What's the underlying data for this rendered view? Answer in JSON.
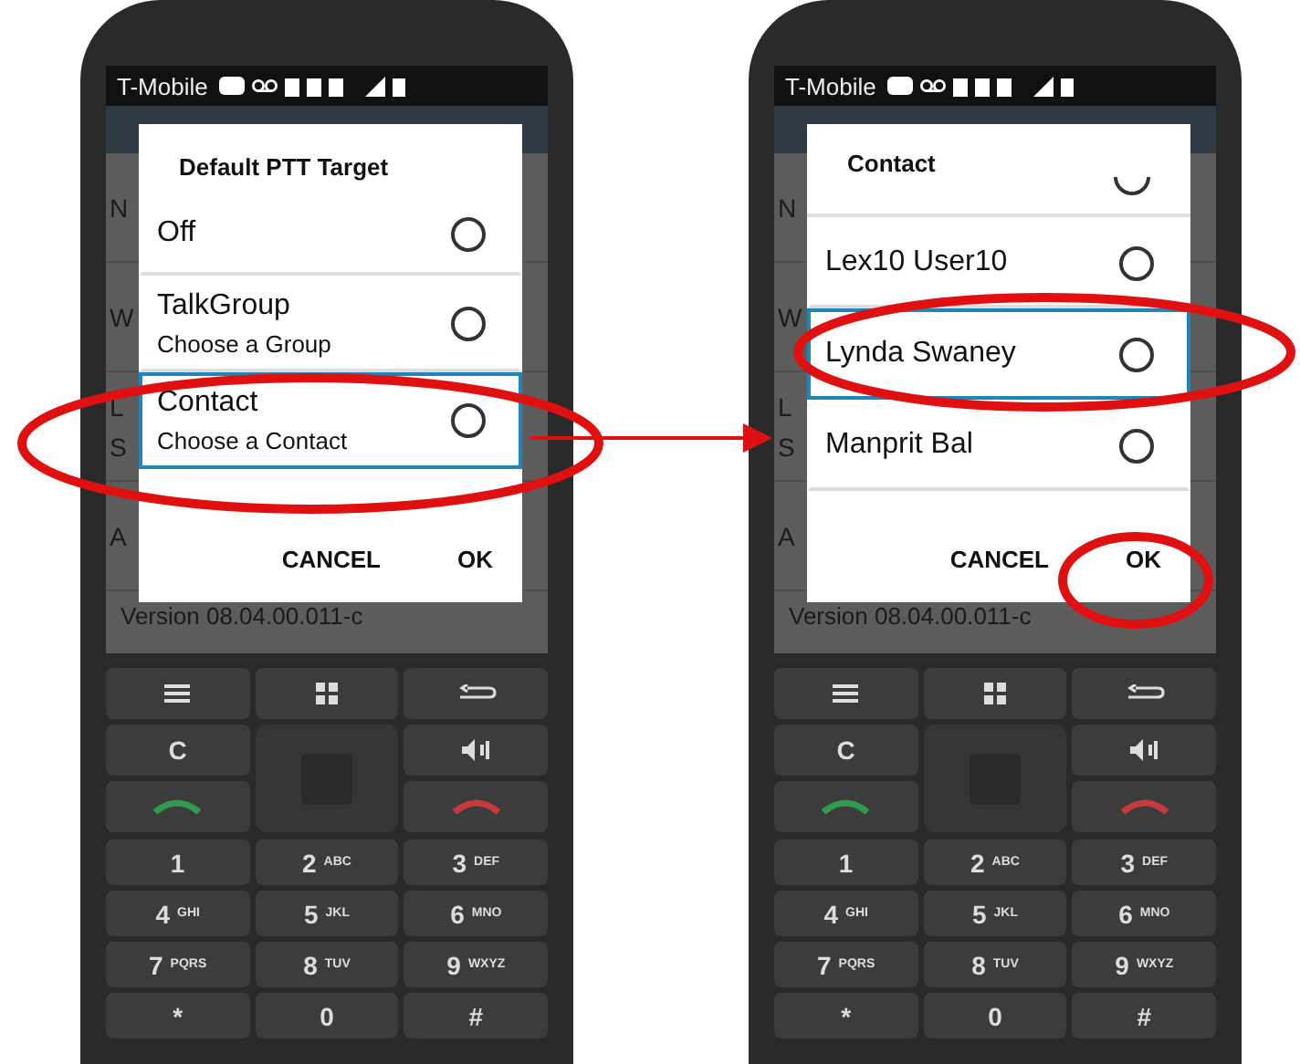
{
  "phones": [
    {
      "status_bar": {
        "carrier": "T-Mobile"
      },
      "background_rows": [
        {
          "texts": [
            "N"
          ]
        },
        {
          "texts": [
            "W"
          ]
        },
        {
          "texts": [
            "L",
            "S"
          ]
        },
        {
          "texts": [
            "A"
          ]
        }
      ],
      "version": "Version 08.04.00.011-c",
      "dialog": {
        "title": "Default PTT Target",
        "options": [
          {
            "label": "Off",
            "selected": false,
            "highlighted": false
          },
          {
            "label": "TalkGroup",
            "sublabel": "Choose a Group",
            "selected": false,
            "highlighted": false
          },
          {
            "label": "Contact",
            "sublabel": "Choose a Contact",
            "selected": false,
            "highlighted": true
          }
        ],
        "buttons": [
          "CANCEL",
          "OK"
        ]
      },
      "function_keys": [
        {
          "kind": "menu"
        },
        {
          "kind": "home"
        },
        {
          "kind": "back"
        },
        {
          "kind": "clear",
          "label": "C"
        },
        {
          "kind": "volume"
        },
        {
          "kind": "call"
        },
        {
          "kind": "end"
        }
      ],
      "digit_keys": [
        {
          "digit": "1"
        },
        {
          "digit": "2",
          "letters": "ABC"
        },
        {
          "digit": "3",
          "letters": "DEF"
        },
        {
          "digit": "4",
          "letters": "GHI"
        },
        {
          "digit": "5",
          "letters": "JKL"
        },
        {
          "digit": "6",
          "letters": "MNO"
        },
        {
          "digit": "7",
          "letters": "PQRS"
        },
        {
          "digit": "8",
          "letters": "TUV"
        },
        {
          "digit": "9",
          "letters": "WXYZ"
        },
        {
          "digit": "*"
        },
        {
          "digit": "0"
        },
        {
          "digit": "#"
        }
      ]
    },
    {
      "status_bar": {
        "carrier": "T-Mobile"
      },
      "background_rows": [
        {
          "texts": [
            "N"
          ]
        },
        {
          "texts": [
            "W"
          ]
        },
        {
          "texts": [
            "L",
            "S"
          ]
        },
        {
          "texts": [
            "A"
          ]
        }
      ],
      "version": "Version 08.04.00.011-c",
      "dialog": {
        "title": "Contact",
        "partial_option": {
          "selected": false
        },
        "options": [
          {
            "label": "Lex10 User10",
            "selected": false,
            "highlighted": false
          },
          {
            "label": "Lynda  Swaney",
            "selected": false,
            "highlighted": true
          },
          {
            "label": "Manprit Bal",
            "selected": false,
            "highlighted": false
          }
        ],
        "buttons": [
          "CANCEL",
          "OK"
        ]
      },
      "function_keys": [
        {
          "kind": "menu"
        },
        {
          "kind": "home"
        },
        {
          "kind": "back"
        },
        {
          "kind": "clear",
          "label": "C"
        },
        {
          "kind": "volume"
        },
        {
          "kind": "call"
        },
        {
          "kind": "end"
        }
      ],
      "digit_keys": [
        {
          "digit": "1"
        },
        {
          "digit": "2",
          "letters": "ABC"
        },
        {
          "digit": "3",
          "letters": "DEF"
        },
        {
          "digit": "4",
          "letters": "GHI"
        },
        {
          "digit": "5",
          "letters": "JKL"
        },
        {
          "digit": "6",
          "letters": "MNO"
        },
        {
          "digit": "7",
          "letters": "PQRS"
        },
        {
          "digit": "8",
          "letters": "TUV"
        },
        {
          "digit": "9",
          "letters": "WXYZ"
        },
        {
          "digit": "*"
        },
        {
          "digit": "0"
        },
        {
          "digit": "#"
        }
      ]
    }
  ]
}
